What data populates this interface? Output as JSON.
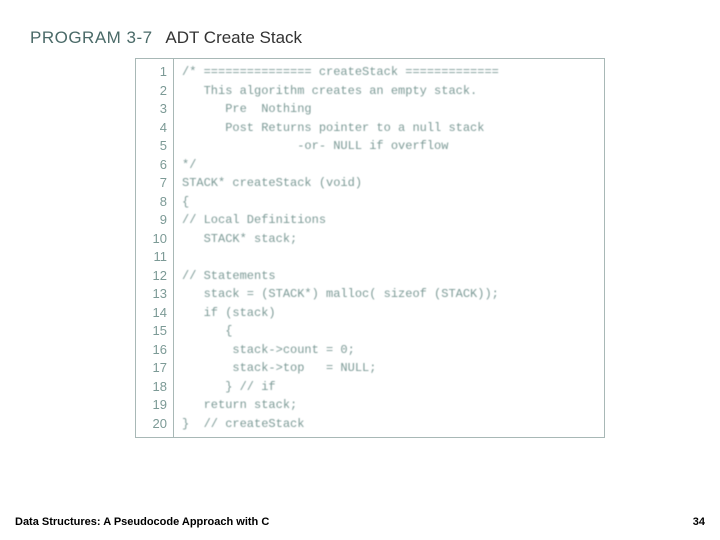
{
  "header": {
    "program_label": "PROGRAM 3-7",
    "title": "ADT Create Stack"
  },
  "line_numbers": [
    "1",
    "2",
    "3",
    "4",
    "5",
    "6",
    "7",
    "8",
    "9",
    "10",
    "11",
    "12",
    "13",
    "14",
    "15",
    "16",
    "17",
    "18",
    "19",
    "20"
  ],
  "code_lines": [
    "/* =============== createStack =============",
    "   This algorithm creates an empty stack.",
    "      Pre  Nothing",
    "      Post Returns pointer to a null stack",
    "                -or- NULL if overflow",
    "*/",
    "STACK* createStack (void)",
    "{",
    "// Local Definitions",
    "   STACK* stack;",
    "",
    "// Statements",
    "   stack = (STACK*) malloc( sizeof (STACK));",
    "   if (stack)",
    "      {",
    "       stack->count = 0;",
    "       stack->top   = NULL;",
    "      } // if",
    "   return stack;",
    "}  // createStack"
  ],
  "footer": {
    "left": "Data Structures: A Pseudocode Approach with C",
    "right": "34"
  }
}
